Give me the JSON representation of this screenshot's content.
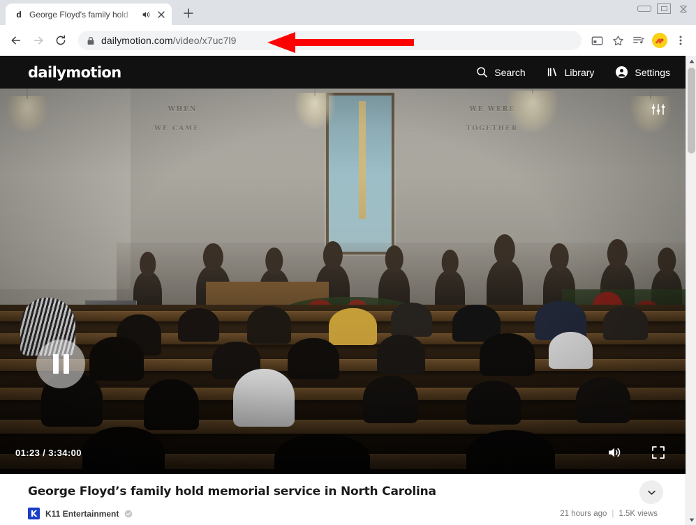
{
  "window": {
    "controls": [
      {
        "name": "minimize",
        "glyph": "—"
      },
      {
        "name": "maximize",
        "glyph": "□"
      },
      {
        "name": "close",
        "glyph": "✕"
      }
    ]
  },
  "browser": {
    "tab": {
      "favicon_letter": "d",
      "title": "George Floyd's family hold",
      "audio_icon": "speaker-playing-icon",
      "close_icon": "close-icon"
    },
    "new_tab_label": "+",
    "toolbar": {
      "back_icon": "back-arrow-icon",
      "forward_icon": "forward-arrow-icon",
      "reload_icon": "reload-icon",
      "lock_icon": "lock-icon",
      "url_domain": "dailymotion.com",
      "url_path": "/video/x7uc7l9",
      "cast_icon": "cast-icon",
      "bookmark_icon": "star-icon",
      "media_icon": "media-playlist-icon",
      "extension_icon": "extension-avatar-icon",
      "menu_icon": "three-dot-menu-icon"
    }
  },
  "site": {
    "logo": "dailymotion",
    "nav": [
      {
        "label": "Search",
        "icon": "search-icon"
      },
      {
        "label": "Library",
        "icon": "library-icon"
      },
      {
        "label": "Settings",
        "icon": "account-circle-icon"
      }
    ]
  },
  "player": {
    "state": "paused",
    "pause_icon": "pause-icon",
    "quality_icon": "quality-sliders-icon",
    "current_time": "01:23",
    "time_separator": "/",
    "duration": "3:34:00",
    "volume_icon": "volume-on-icon",
    "fullscreen_icon": "fullscreen-icon",
    "scene_text": {
      "left_line1": "WHEN",
      "left_line2": "WE CAME",
      "right_line1": "WE WERE",
      "right_line2": "TOGETHER"
    }
  },
  "video": {
    "title": "George Floyd’s family hold memorial service in North Carolina",
    "expand_icon": "chevron-down-icon",
    "channel": {
      "avatar_letter": "K",
      "name": "K11 Entertainment",
      "verified_icon": "verified-check-icon"
    },
    "published": "21 hours ago",
    "separator": "|",
    "views": "1.5K views"
  },
  "scrollbar": {
    "up_icon": "scroll-up-arrow-icon",
    "down_icon": "scroll-down-arrow-icon"
  },
  "annotation": {
    "arrow_icon": "red-arrow-left-icon",
    "color": "#ff0000"
  },
  "colors": {
    "chrome_bg": "#dee1e6",
    "toolbar_bg": "#ffffff",
    "omnibox_bg": "#f1f3f4",
    "site_header_bg": "#111111",
    "player_bg": "#000000",
    "annotation_red": "#ff0000",
    "channel_avatar_blue": "#1a3cc8"
  }
}
